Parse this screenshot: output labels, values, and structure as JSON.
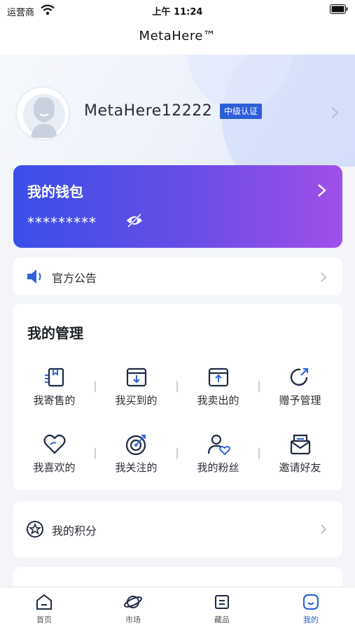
{
  "status_bar": {
    "carrier": "运营商",
    "time": "上午 11:24"
  },
  "nav": {
    "title": "MetaHere™"
  },
  "profile": {
    "username": "MetaHere12222",
    "badge": "中级认证"
  },
  "wallet": {
    "title": "我的钱包",
    "balance_masked": "*********"
  },
  "notice": {
    "label": "官方公告"
  },
  "management": {
    "title": "我的管理",
    "items": [
      {
        "label": "我寄售的",
        "icon": "consign-box-icon"
      },
      {
        "label": "我买到的",
        "icon": "box-download-icon"
      },
      {
        "label": "我卖出的",
        "icon": "box-upload-icon"
      },
      {
        "label": "赠予管理",
        "icon": "share-arrow-icon"
      },
      {
        "label": "我喜欢的",
        "icon": "heart-icon"
      },
      {
        "label": "我关注的",
        "icon": "target-icon"
      },
      {
        "label": "我的粉丝",
        "icon": "user-heart-icon"
      },
      {
        "label": "邀请好友",
        "icon": "mail-invite-icon"
      }
    ]
  },
  "points": {
    "label": "我的积分"
  },
  "tabs": [
    {
      "label": "首页",
      "icon": "home-icon",
      "active": false
    },
    {
      "label": "市场",
      "icon": "planet-icon",
      "active": false
    },
    {
      "label": "藏品",
      "icon": "collection-icon",
      "active": false
    },
    {
      "label": "我的",
      "icon": "smile-face-icon",
      "active": true
    }
  ],
  "colors": {
    "accent": "#2d63d6",
    "wallet_start": "#3a4fe8",
    "wallet_end": "#a14fe9",
    "badge": "#2c5fd7"
  }
}
